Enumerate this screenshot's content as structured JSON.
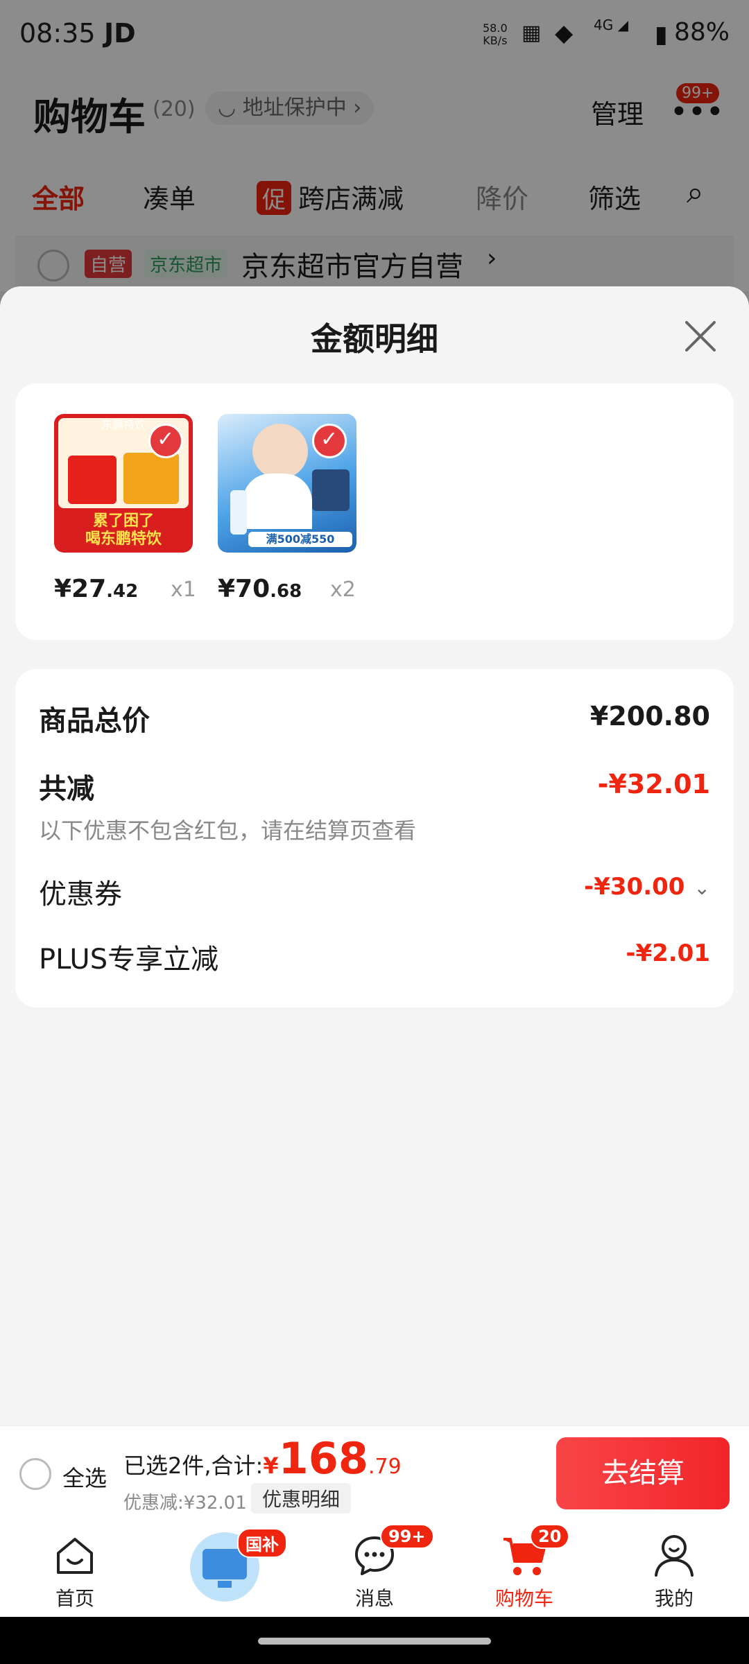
{
  "status_bar": {
    "time": "08:35",
    "carrier": "JD",
    "net_speed": "58.0",
    "net_unit": "KB/s",
    "signal": "4G",
    "battery": "88%"
  },
  "header": {
    "title": "购物车",
    "count": "(20)",
    "address_protect": "地址保护中",
    "manage": "管理",
    "more_badge": "99+"
  },
  "tabs": [
    {
      "label": "全部",
      "active": true
    },
    {
      "label": "凑单"
    },
    {
      "label": "跨店满减",
      "tag": "促"
    },
    {
      "label": "降价"
    },
    {
      "label": "筛选"
    }
  ],
  "store": {
    "tag_self": "自营",
    "tag_store": "京东超市",
    "name": "京东超市官方自营"
  },
  "sheet": {
    "title": "金额明细",
    "products": [
      {
        "price_int": "¥27",
        "price_dec": ".42",
        "qty": "x1",
        "banner_top": "东鹏特饮",
        "banner_text_1": "累了困了",
        "banner_text_2": "喝东鹏特饮"
      },
      {
        "price_int": "¥70",
        "price_dec": ".68",
        "qty": "x2",
        "banner_text": "满500减550"
      }
    ],
    "summary": {
      "total_label": "商品总价",
      "total_value": "¥200.80",
      "reduce_label": "共减",
      "reduce_value": "-¥32.01",
      "reduce_note": "以下优惠不包含红包，请在结算页查看",
      "coupon_label": "优惠券",
      "coupon_value": "-¥30.00",
      "plus_label": "PLUS专享立减",
      "plus_value": "-¥2.01"
    }
  },
  "checkout": {
    "select_all": "全选",
    "selected_text": "已选2件,合计:",
    "currency": "¥",
    "total_int": "168",
    "total_dec": ".79",
    "discount_text": "优惠减:¥32.01",
    "detail_button": "优惠明细",
    "go_button": "去结算"
  },
  "nav": [
    {
      "label": "首页",
      "icon": "home-icon"
    },
    {
      "label": "",
      "icon": "subsidy-icon",
      "badge": "国补"
    },
    {
      "label": "消息",
      "icon": "message-icon",
      "badge": "99+"
    },
    {
      "label": "购物车",
      "icon": "cart-icon",
      "badge": "20",
      "active": true
    },
    {
      "label": "我的",
      "icon": "profile-icon"
    }
  ],
  "colors": {
    "accent": "#f0250f",
    "dim_overlay": "rgba(0,0,0,0.45)"
  }
}
